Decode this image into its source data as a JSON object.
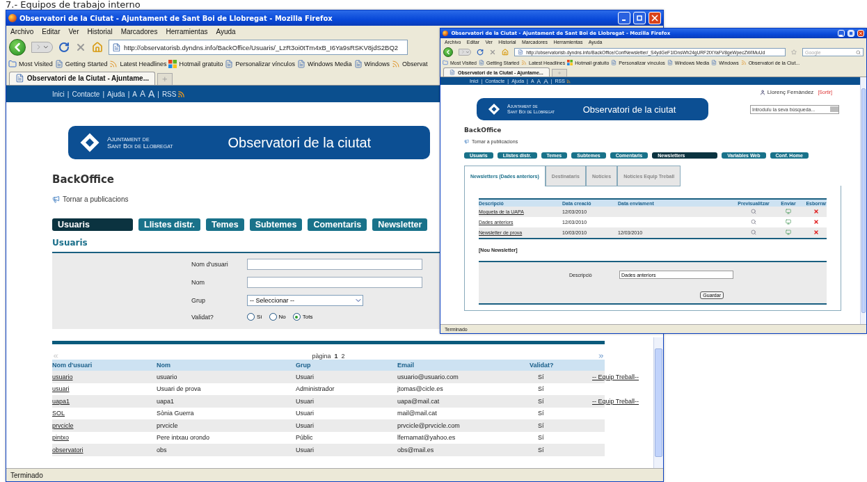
{
  "heading": "7.- Equipos de trabajo interno",
  "back_window": {
    "title": "Observatori de la Ciutat - Ajuntament de Sant Boi de Llobregat - Mozilla Firefox",
    "menu": [
      "Archivo",
      "Editar",
      "Ver",
      "Historial",
      "Marcadores",
      "Herramientas",
      "Ayuda"
    ],
    "url": "http://observatorisb.dyndns.info/BackOffice/Usuaris/_LzR3oi0tTm4xB_I6Ya9sRSKV8jdS2BQ2",
    "bookmarks": [
      {
        "kind": "smart",
        "label": "Most Visited"
      },
      {
        "kind": "page",
        "label": "Getting Started"
      },
      {
        "kind": "feed",
        "label": "Latest Headlines"
      },
      {
        "kind": "windows",
        "label": "Hotmail gratuito"
      },
      {
        "kind": "page",
        "label": "Personalizar vínculos"
      },
      {
        "kind": "page",
        "label": "Windows Media"
      },
      {
        "kind": "page",
        "label": "Windows"
      },
      {
        "kind": "feed",
        "label": "Observat"
      }
    ],
    "tabs": [
      {
        "label": "Observatori de la Ciutat - Ajuntame...",
        "selected": true
      }
    ],
    "status": "Terminado",
    "page": {
      "top_links": [
        {
          "kind": "link",
          "label": "Inici"
        },
        {
          "kind": "link",
          "label": "Contacte"
        },
        {
          "kind": "link",
          "label": "Ajuda"
        },
        {
          "kind": "size",
          "label": "A"
        },
        {
          "kind": "size",
          "label": "A"
        },
        {
          "kind": "size",
          "label": "A"
        },
        {
          "kind": "feed",
          "label": "RSS"
        }
      ],
      "separator": "|",
      "banner": {
        "org_line_1": "Ajuntament de",
        "org_line_2": "Sant Boi de Llobregat",
        "title": "Observatori de la ciutat"
      },
      "section_title": "BackOffice",
      "back_link": "Tornar a publicacions",
      "nav": [
        {
          "label": "Usuaris",
          "selected": true
        },
        {
          "label": "Llistes distr.",
          "selected": false
        },
        {
          "label": "Temes",
          "selected": false
        },
        {
          "label": "Subtemes",
          "selected": false
        },
        {
          "label": "Comentaris",
          "selected": false
        },
        {
          "label": "Newsletter",
          "selected": false
        }
      ],
      "panel_title": "Usuaris",
      "form": [
        {
          "kind": "text",
          "label": "Nom d'usuari"
        },
        {
          "kind": "text",
          "label": "Nom"
        },
        {
          "kind": "select",
          "label": "Grup",
          "value": "-- Seleccionar --"
        },
        {
          "kind": "radio",
          "label": "Validat?",
          "options": [
            {
              "label": "Sí",
              "selected": false
            },
            {
              "label": "No",
              "selected": false
            },
            {
              "label": "Tots",
              "selected": true
            }
          ]
        }
      ],
      "pager": {
        "label": "pàgina",
        "pages": [
          {
            "label": "1",
            "selected": true
          },
          {
            "label": "2",
            "selected": false
          }
        ]
      },
      "table": {
        "columns": [
          "Nom d'usuari",
          "Nom",
          "Grup",
          "Email",
          "Validat?"
        ],
        "rows": [
          {
            "user": "usuario",
            "name": "usuario",
            "group": "Usuari",
            "email": "usuario@usuario.com",
            "validated": "Sí",
            "team": "-- Equip Treball--"
          },
          {
            "user": "usuari",
            "name": "Usuari de prova",
            "group": "Administrador",
            "email": "jtomas@cicle.es",
            "validated": "Sí"
          },
          {
            "user": "uapa1",
            "name": "uapa1",
            "group": "Usuari",
            "email": "uapa@mail.cat",
            "validated": "Sí",
            "team": "-- Equip Treball--"
          },
          {
            "user": "SOL",
            "name": "Sònia Guerra",
            "group": "Usuari",
            "email": "mail@mail.cat",
            "validated": "Sí"
          },
          {
            "user": "prvcicle",
            "name": "prvcicle",
            "group": "Usuari",
            "email": "prvcicle@prvcicle.com",
            "validated": "Sí"
          },
          {
            "user": "pintxo",
            "name": "Pere intxau orondo",
            "group": "Públic",
            "email": "lfernamat@yahoo.es",
            "validated": "Sí"
          },
          {
            "user": "observatori",
            "name": "obs",
            "group": "Usuari",
            "email": "obs@mail.es",
            "validated": "Sí"
          }
        ]
      }
    }
  },
  "front_window": {
    "title": "Observatori de la Ciutat - Ajuntament de Sant Boi de Llobregat - Mozilla Firefox",
    "menu": [
      "Archivo",
      "Editar",
      "Ver",
      "Historial",
      "Marcadores",
      "Herramientas",
      "Ayuda"
    ],
    "url": "http://observatorisb.dyndns.info/BackOffice/ConfNewsletter/_S4ydGeF1IDnsWh24gURF2tXYaFV8geWpecZWIMuUd",
    "search_placeholder": "Google",
    "bookmarks": [
      {
        "kind": "smart",
        "label": "Most Visited"
      },
      {
        "kind": "page",
        "label": "Getting Started"
      },
      {
        "kind": "feed",
        "label": "Latest Headlines"
      },
      {
        "kind": "windows",
        "label": "Hotmail gratuito"
      },
      {
        "kind": "page",
        "label": "Personalizar vínculos"
      },
      {
        "kind": "page",
        "label": "Windows Media"
      },
      {
        "kind": "page",
        "label": "Windows"
      },
      {
        "kind": "feed",
        "label": "Observatori de la Ciut..."
      }
    ],
    "tabs": [
      {
        "label": "Observatori de la Ciutat - Ajuntame...",
        "selected": true
      }
    ],
    "status": "Terminado",
    "page": {
      "top_links": [
        {
          "kind": "link",
          "label": "Inici"
        },
        {
          "kind": "link",
          "label": "Contacte"
        },
        {
          "kind": "link",
          "label": "Ajuda"
        },
        {
          "kind": "size",
          "label": "A"
        },
        {
          "kind": "size",
          "label": "A"
        },
        {
          "kind": "size",
          "label": "A"
        },
        {
          "kind": "feed",
          "label": "RSS"
        }
      ],
      "separator": "|",
      "user": {
        "name": "Llorenç Fernàndez",
        "logout": "[Sortir]"
      },
      "banner": {
        "org_line_1": "Ajuntament de",
        "org_line_2": "Sant Boi de Llobregat",
        "title": "Observatori de la ciutat"
      },
      "search_placeholder": "Introduïu la seva búsqueda...",
      "section_title": "BackOffice",
      "back_link": "Tornar a publicacions",
      "nav": [
        {
          "label": "Usuaris",
          "selected": false
        },
        {
          "label": "Llistes distr.",
          "selected": false
        },
        {
          "label": "Temes",
          "selected": false
        },
        {
          "label": "Subtemes",
          "selected": false
        },
        {
          "label": "Comentaris",
          "selected": false
        },
        {
          "label": "Newsletters",
          "selected": true
        },
        {
          "label": "Variables Web",
          "selected": false
        },
        {
          "label": "Conf. Home",
          "selected": false
        }
      ],
      "subtabs": [
        {
          "label": "Newsletters (Dades anteriors)",
          "selected": true
        },
        {
          "label": "Destinataris",
          "selected": false
        },
        {
          "label": "Notícies",
          "selected": false
        },
        {
          "label": "Notícies Equip Treball",
          "selected": false
        }
      ],
      "table": {
        "columns": [
          "Descripció",
          "Data creació",
          "Data enviament",
          "Previsualitzar",
          "Enviar",
          "Esborrar"
        ],
        "rows": [
          {
            "description": "Moqueta de la UAPA",
            "created": "12/03/2010"
          },
          {
            "description": "Dades anteriors",
            "created": "12/03/2010"
          },
          {
            "description": "Newsletter de prova",
            "created": "10/03/2010",
            "sent": "12/03/2010"
          }
        ]
      },
      "new_link": "[Nou Newsletter]",
      "form": {
        "label": "Descripció",
        "value": "Dades anteriors"
      },
      "save": "Guardar"
    }
  }
}
